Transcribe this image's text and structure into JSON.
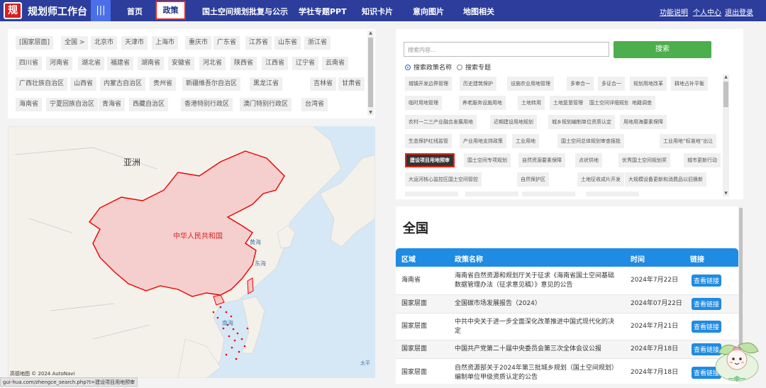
{
  "nav": {
    "logo": "规",
    "brand": "规划师工作台",
    "menu_icon": "|||",
    "items": [
      "首页",
      "政策",
      "国土空间规划批复与公示",
      "学社专题PPT",
      "知识卡片",
      "意向图片",
      "地图相关"
    ],
    "right": [
      "功能说明",
      "个人中心",
      "退出登录"
    ]
  },
  "regions": [
    [
      "[国家层面]",
      "全国 >",
      "北京市",
      "天津市",
      "上海市",
      "重庆市",
      "广东省",
      "江苏省",
      "山东省",
      "浙江省"
    ],
    [
      "四川省",
      "河南省",
      "湖北省",
      "福建省",
      "湖南省",
      "安徽省",
      "河北省",
      "陕西省",
      "江西省",
      "辽宁省",
      "云南省"
    ],
    [
      "广西壮族自治区",
      "山西省",
      "内蒙古自治区",
      "贵州省",
      "新疆维吾尔自治区",
      "黑龙江省",
      "吉林省",
      "甘肃省"
    ],
    [
      "海南省",
      "宁夏回族自治区",
      "青海省",
      "西藏自治区",
      "香港特别行政区",
      "澳门特别行政区",
      "台湾省"
    ]
  ],
  "map": {
    "labels": {
      "asia": "亚洲",
      "china": "中华人民共和国",
      "yellow_sea": "黄海",
      "east_sea": "东海",
      "south_sea": "南海",
      "pacific": "太平"
    },
    "attribution": "高德地图 © 2024 AutoNavi"
  },
  "search": {
    "placeholder": "搜索内容...",
    "button": "搜索",
    "radio_policy": "搜索政策名称",
    "radio_topic": "搜索专题"
  },
  "tags": [
    [
      "城镇开发边界管理",
      "历史建筑保护",
      "设施农业用地管理",
      "多审合一",
      "多证合一",
      "规划用地改革",
      "耕地占补平衡"
    ],
    [
      "临时用地管理",
      "养老服务设施用地",
      "土地转用",
      "土地复垦管理",
      "国土空间详细规划编制",
      "地籍调查"
    ],
    [
      "农村一二三产业融合发展用地",
      "近期建设用地规划",
      "城乡规划编制单位资质认定",
      "用地用海要素保障"
    ],
    [
      "生态保护红线监管",
      "产业用地支持政策",
      "工业用地",
      "国土空间总体规划审查报批",
      "工业用地“标准地”出让"
    ],
    [
      "建设项目用地预审",
      "国土空间专项规划",
      "自然资源要素保障",
      "点状供地",
      "优秀国土空间规划奖",
      "城市更新行动"
    ],
    [
      "大运河核心监控区国土空间管控",
      "自然保护区",
      "土地征收成片开发",
      "大规模设备更新和消费品以旧换新"
    ]
  ],
  "results": {
    "region_title": "全国",
    "headers": [
      "区域",
      "政策名称",
      "时间",
      "链接"
    ],
    "rows": [
      {
        "region": "海南省",
        "name": "海南省自然资源和规划厅关于征求《海南省国土空间基础数据管理办法（征求意见稿）》意见的公告",
        "date": "2024年7月22日",
        "link": "查看链接"
      },
      {
        "region": "国家层面",
        "name": "全国碳市场发展报告（2024）",
        "date": "2024年07月22日",
        "link": "查看链接"
      },
      {
        "region": "国家层面",
        "name": "中共中央关于进一步全面深化改革推进中国式现代化的决定",
        "date": "2024年7月21日",
        "link": "查看链接"
      },
      {
        "region": "国家层面",
        "name": "中国共产党第二十届中央委员会第三次全体会议公报",
        "date": "2024年7月18日",
        "link": "查看链接"
      },
      {
        "region": "国家层面",
        "name": "自然资源部关于2024年第三批城乡规划（国土空间规划）编制单位甲级资质认定的公告",
        "date": "2024年7月18日",
        "link": "查看链接"
      }
    ]
  },
  "status_url": "gui-hua.com/zhengce_search.php?t=建设项目用地预审",
  "mascot_text": "一中一",
  "colors": {
    "nav": "#2c3d9b",
    "accent_blue": "#1f8be3",
    "search_green": "#4cae4c",
    "highlight_red": "#e21"
  }
}
